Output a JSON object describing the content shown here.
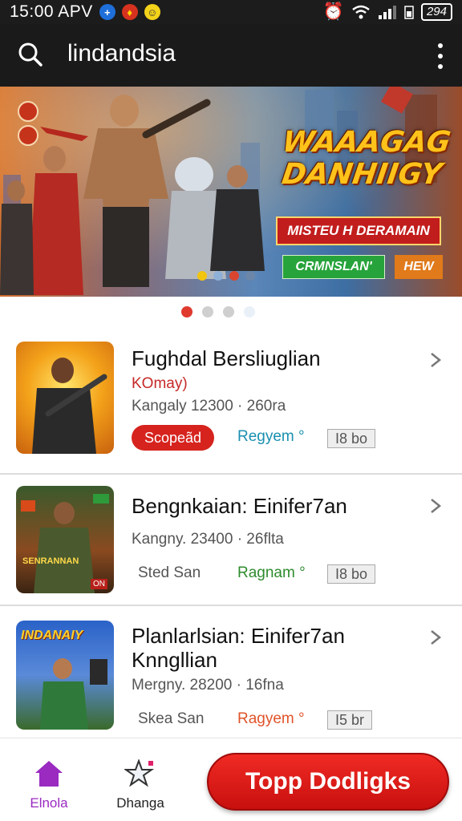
{
  "status_bar": {
    "time": "15:00 APV",
    "battery": "294",
    "icons": [
      "plus-badge-icon",
      "map-pin-icon",
      "emoji-icon",
      "alarm-icon",
      "wifi-icon",
      "signal-icon",
      "battery-icon"
    ]
  },
  "app_bar": {
    "title": "lindandsia",
    "search_icon": "search-icon",
    "menu_icon": "more-vertical-icon"
  },
  "banner": {
    "game_title_line1": "WAAAGAG",
    "game_title_line2": "DANHIIGY",
    "subtitle": "MISTEU H DERAMAIN",
    "green_button": "CRMNSLAN'",
    "orange_button": "HEW",
    "colors": {
      "title": "#ffc21a",
      "subtitle_bg": "#c21d1d",
      "green": "#27a33b",
      "orange": "#e07a1a"
    }
  },
  "carousel": {
    "count": 4,
    "active_index": 0
  },
  "items": [
    {
      "title": "Fughdal Bersliuglian",
      "subtitle": "KOmay)",
      "meta": "Kangaly 12300 ·  260ra",
      "tag_primary": "Scopeãd",
      "tag_link": "Regyem",
      "tag_link_color": "#1a8fb0",
      "tag_box": "I8 bo"
    },
    {
      "title": "Bengnkaian: Einifer7an",
      "meta": "Kangny. 23400 ·  26flta",
      "tag_primary": "Sted San",
      "tag_link": "Ragnam",
      "tag_link_color": "#2e8b2e",
      "tag_box": "I8 bo",
      "thumb_text": "SENRANNAN",
      "thumb_badge": "ON"
    },
    {
      "title_line1": "Planlarlsian: Einifer7an",
      "title_line2": "Knngllian",
      "meta": "Mergny. 28200 ·  16fna",
      "tag_primary": "Skea San",
      "tag_link": "Ragyem",
      "tag_link_color": "#e0542a",
      "tag_box": "I5 br",
      "thumb_text": "INDANAIY"
    }
  ],
  "bottom_nav": {
    "home_label": "Elnola",
    "favorites_label": "Dhanga",
    "cta_label": "Topp Dodligks",
    "accent": "#9a2ac0",
    "cta_color": "#e0201c"
  }
}
